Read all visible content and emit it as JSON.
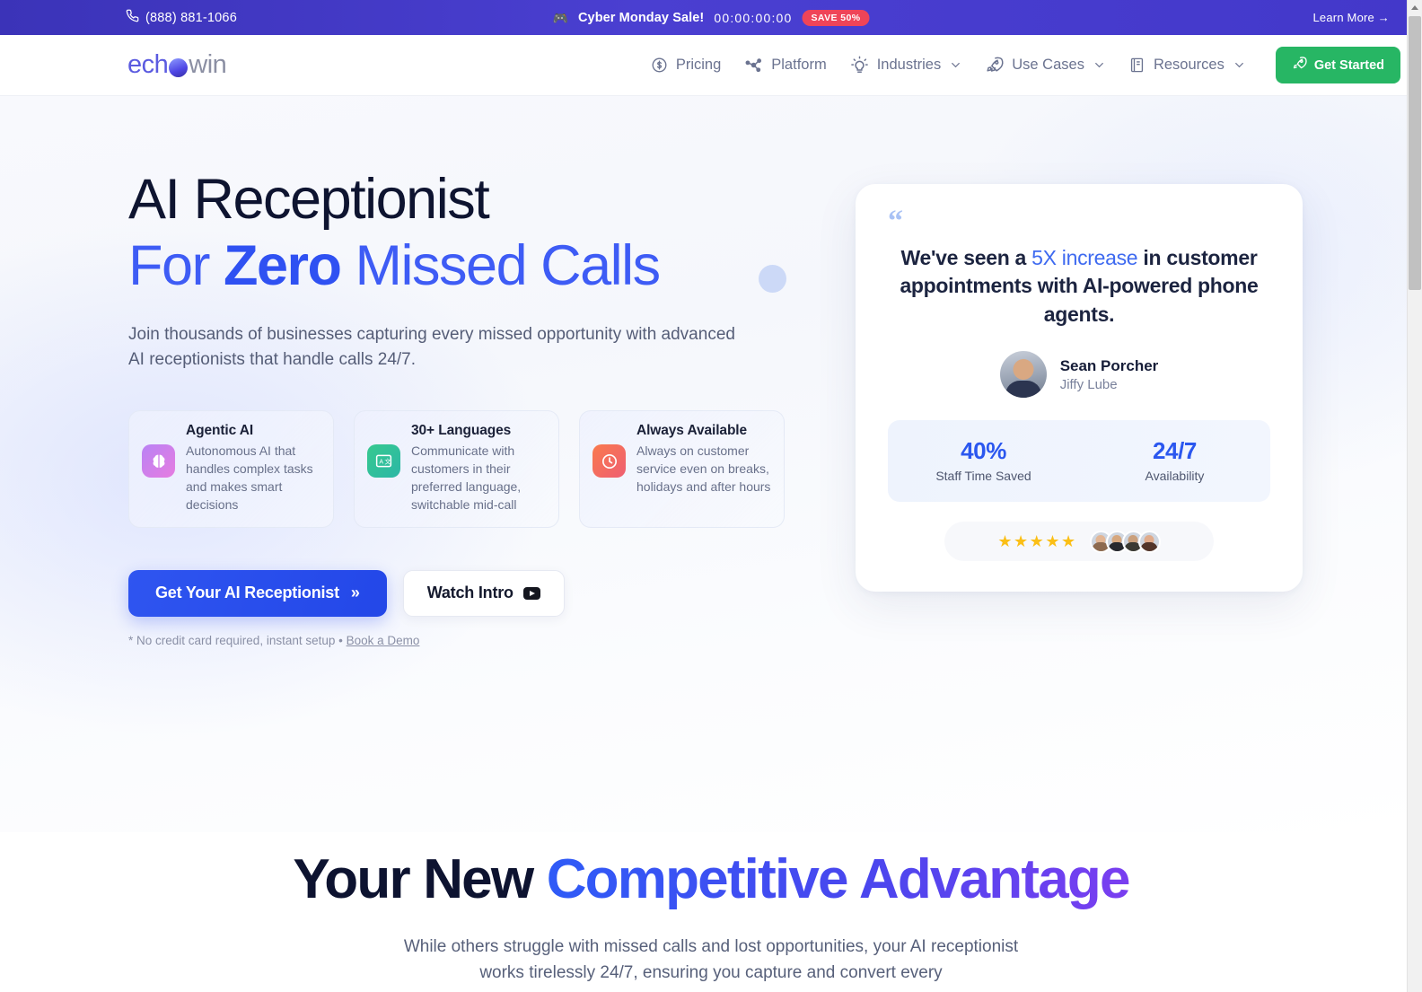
{
  "promo": {
    "phone": "(888) 881-1066",
    "phone_icon": "phone-icon",
    "emoji": "🎮",
    "title": "Cyber Monday Sale!",
    "timer": "00:00:00:00",
    "badge": "SAVE 50%",
    "learn_more": "Learn More →",
    "bg_color": "#4338ca",
    "badge_color": "#ef4458"
  },
  "nav": {
    "logo_text_1": "ech",
    "logo_text_2": "win",
    "items": [
      {
        "label": "Pricing",
        "icon": "dollar-circle-icon",
        "caret": false
      },
      {
        "label": "Platform",
        "icon": "network-nodes-icon",
        "caret": false
      },
      {
        "label": "Industries",
        "icon": "lightbulb-icon",
        "caret": true
      },
      {
        "label": "Use Cases",
        "icon": "rocket-icon",
        "caret": true
      },
      {
        "label": "Resources",
        "icon": "book-icon",
        "caret": true
      }
    ],
    "cta": {
      "label": "Get Started",
      "icon": "rocket-icon",
      "color": "#27b664"
    }
  },
  "hero": {
    "headline_line1": "AI Receptionist",
    "headline_line2_pre": "For ",
    "headline_line2_bold": "Zero",
    "headline_line2_post": " Missed Calls",
    "subheadline": "Join thousands of businesses capturing every missed opportunity with advanced AI receptionists that handle calls 24/7.",
    "accent_color": "#3e5cf5",
    "features": [
      {
        "title": "Agentic AI",
        "desc": "Autonomous AI that handles complex tasks and makes smart decisions",
        "icon": "brain-icon",
        "icon_color": "#c27ef0"
      },
      {
        "title": "30+ Languages",
        "desc": "Communicate with customers in their preferred language, switchable mid-call",
        "icon": "translate-icon",
        "icon_color": "#32c196"
      },
      {
        "title": "Always Available",
        "desc": "Always on customer service even on breaks, holidays and after hours",
        "icon": "clock-icon",
        "icon_color": "#f3694f"
      }
    ],
    "primary_cta": "Get Your AI Receptionist",
    "primary_cta_arrow": "»",
    "secondary_cta": "Watch Intro",
    "secondary_cta_icon": "youtube-icon",
    "fineprint_text": "* No credit card required, instant setup • ",
    "fineprint_link": "Book a Demo"
  },
  "testimonial": {
    "quote_icon": "quote-mark-icon",
    "quote_pre": "We've seen a ",
    "quote_highlight": "5X increase",
    "quote_post": " in customer appointments with AI-powered phone agents.",
    "author_name": "Sean Porcher",
    "author_company": "Jiffy Lube",
    "author_avatar": "avatar",
    "stats": [
      {
        "value": "40%",
        "label": "Staff Time Saved"
      },
      {
        "value": "24/7",
        "label": "Availability"
      }
    ],
    "stat_color": "#2b57ef",
    "stars": "★★★★★",
    "star_count": 5,
    "star_color": "#fbbf16",
    "avatar_count": 4
  },
  "section2": {
    "title_pre": "Your New ",
    "title_gradient": "Competitive Advantage",
    "subtitle": "While others struggle with missed calls and lost opportunities, your AI receptionist works tirelessly 24/7, ensuring you capture and convert every"
  }
}
